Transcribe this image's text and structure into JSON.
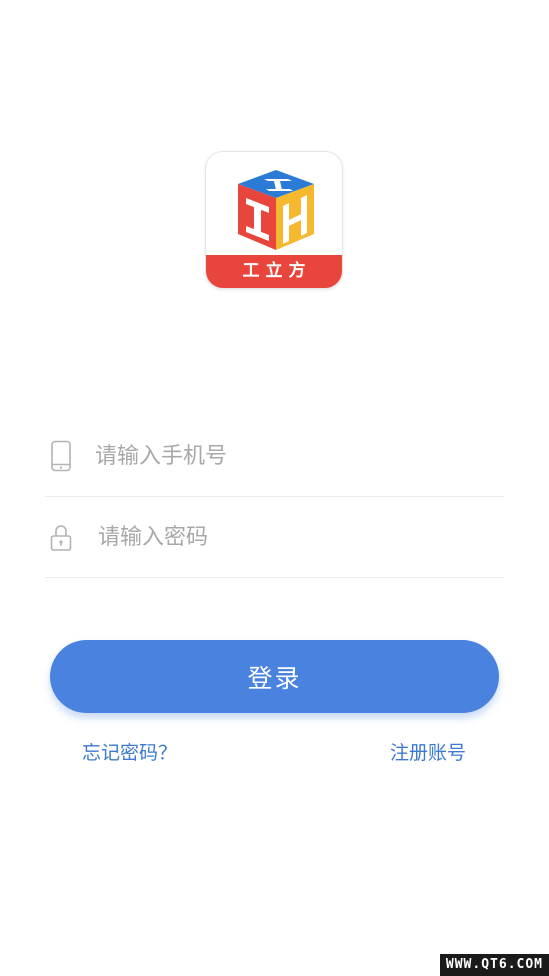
{
  "logo": {
    "app_name": "工立方",
    "colors": {
      "red": "#e8453c",
      "blue": "#2a7bd6",
      "yellow": "#f5b82e"
    }
  },
  "form": {
    "phone": {
      "icon": "phone-icon",
      "placeholder": "请输入手机号",
      "value": ""
    },
    "password": {
      "icon": "lock-icon",
      "placeholder": "请输入密码",
      "value": ""
    },
    "login_label": "登录"
  },
  "links": {
    "forgot_password": "忘记密码？",
    "register": "注册账号"
  },
  "watermark": "WWW.QT6.COM",
  "colors": {
    "primary": "#4a82df",
    "link": "#3d79cf",
    "placeholder": "#a8a8a8"
  }
}
